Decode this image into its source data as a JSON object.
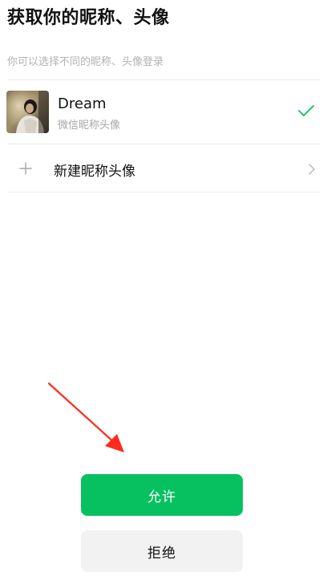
{
  "header": {
    "title": "获取你的昵称、头像",
    "subtitle": "你可以选择不同的昵称、头像登录"
  },
  "profiles": [
    {
      "name": "Dream",
      "description": "微信昵称头像",
      "selected": true,
      "avatar_icon": "user-photo-avatar",
      "selected_icon": "checkmark-icon"
    }
  ],
  "new_profile": {
    "label": "新建昵称头像",
    "leading_icon": "plus-icon",
    "trailing_icon": "chevron-right-icon"
  },
  "actions": {
    "allow_label": "允许",
    "deny_label": "拒绝"
  },
  "annotation": {
    "icon": "red-arrow-pointer"
  },
  "colors": {
    "accent": "#07c160",
    "deny_background": "#f2f2f2",
    "subtitle_text": "#b2b2b2",
    "arrow": "#ff2a1f"
  }
}
